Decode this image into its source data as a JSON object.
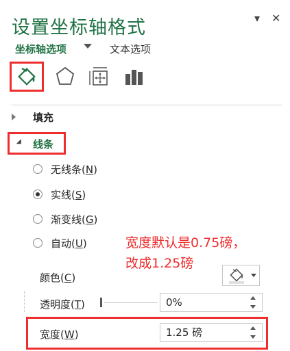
{
  "pane": {
    "title": "设置坐标轴格式",
    "dropdown_button": "▾",
    "close_button": "✕"
  },
  "tabs": {
    "axis_options": "坐标轴选项",
    "text_options": "文本选项"
  },
  "categories": {
    "icons": [
      "paint-bucket-icon",
      "pentagon-icon",
      "size-properties-icon",
      "bar-chart-icon"
    ]
  },
  "sections": {
    "fill": {
      "label": "填充",
      "expanded": false
    },
    "line": {
      "label": "线条",
      "expanded": true
    }
  },
  "line_options": [
    {
      "label": "无线条",
      "key": "N",
      "checked": false
    },
    {
      "label": "实线",
      "key": "S",
      "checked": true
    },
    {
      "label": "渐变线",
      "key": "G",
      "checked": false
    },
    {
      "label": "自动",
      "key": "U",
      "checked": false
    }
  ],
  "annotation": {
    "line1": "宽度默认是0.75磅，",
    "line2": "改成1.25磅"
  },
  "properties": {
    "color": {
      "label": "颜色",
      "key": "C"
    },
    "transparency": {
      "label": "透明度",
      "key": "T",
      "value": "0%",
      "slider_fraction": 0
    },
    "width": {
      "label": "宽度",
      "key": "W",
      "value": "1.25 磅"
    }
  },
  "colors": {
    "accent": "#217346",
    "highlight_red": "#ee2d2d"
  }
}
